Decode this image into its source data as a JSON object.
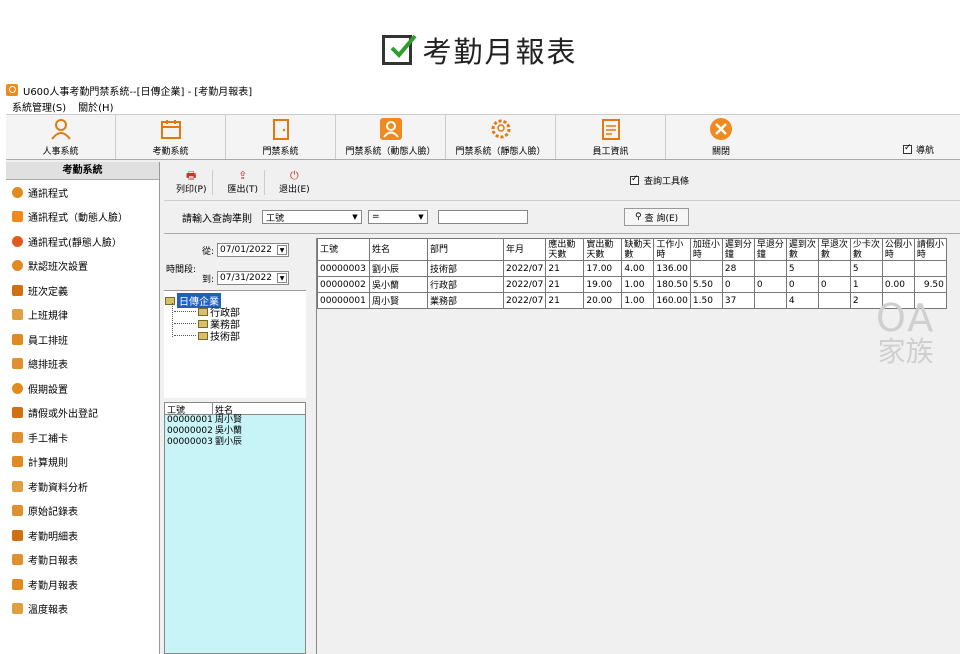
{
  "banner": {
    "title": "考勤月報表"
  },
  "app": {
    "window_title": "U600人事考勤門禁系統--[日傳企業] - [考勤月報表]",
    "menu": [
      "系統管理(S)",
      "關於(H)"
    ]
  },
  "toolbar": {
    "buttons": [
      {
        "label": "人事系統",
        "icon": "person-icon"
      },
      {
        "label": "考勤系統",
        "icon": "calendar-icon"
      },
      {
        "label": "門禁系統",
        "icon": "door-icon"
      },
      {
        "label": "門禁系統（動態人臉）",
        "icon": "face-icon"
      },
      {
        "label": "門禁系統（靜態人臉）",
        "icon": "gear-face-icon"
      },
      {
        "label": "員工資訊",
        "icon": "document-icon"
      },
      {
        "label": "關閉",
        "icon": "close-icon"
      }
    ],
    "nav_label": "導航"
  },
  "sidebar": {
    "header": "考勤系統",
    "items": [
      "通訊程式",
      "通訊程式（動態人臉）",
      "通訊程式(靜態人臉）",
      "默認班次設置",
      "班次定義",
      "上班規律",
      "員工排班",
      "總排班表",
      "假期設置",
      "請假或外出登記",
      "手工補卡",
      "計算規則",
      "考勤資料分析",
      "原始記錄表",
      "考勤明細表",
      "考勤日報表",
      "考勤月報表",
      "溫度報表"
    ]
  },
  "actions": {
    "print": "列印(P)",
    "export": "匯出(T)",
    "exit": "退出(E)",
    "query_toolbar": "查詢工具條"
  },
  "query": {
    "label": "請輸入查詢準則",
    "field": "工號",
    "operator": "=",
    "value": "",
    "button": "查 詢(E)"
  },
  "filter": {
    "period_label": "時間段:",
    "from_label": "從:",
    "to_label": "到:",
    "from_date": "07/01/2022",
    "to_date": "07/31/2022"
  },
  "tree": {
    "root": "日傳企業",
    "children": [
      "行政部",
      "業務部",
      "技術部"
    ]
  },
  "employees": {
    "headers": [
      "工號",
      "姓名"
    ],
    "rows": [
      [
        "00000001",
        "周小賢"
      ],
      [
        "00000002",
        "吳小蘭"
      ],
      [
        "00000003",
        "劉小辰"
      ]
    ]
  },
  "report": {
    "headers": [
      "工號",
      "姓名",
      "部門",
      "年月",
      "應出勤天數",
      "實出勤天數",
      "缺勤天數",
      "工作小時",
      "加班小時",
      "遲到分鐘",
      "早退分鐘",
      "遲到次數",
      "早退次數",
      "少卡次數",
      "公假小時",
      "請假小時"
    ],
    "rows": [
      [
        "00000003",
        "劉小辰",
        "技術部",
        "2022/07",
        "21",
        "17.00",
        "4.00",
        "136.00",
        "",
        "28",
        "",
        "5",
        "",
        "5",
        "",
        ""
      ],
      [
        "00000002",
        "吳小蘭",
        "行政部",
        "2022/07",
        "21",
        "19.00",
        "1.00",
        "180.50",
        "5.50",
        "0",
        "0",
        "0",
        "0",
        "1",
        "0.00",
        "9.50"
      ],
      [
        "00000001",
        "周小賢",
        "業務部",
        "2022/07",
        "21",
        "20.00",
        "1.00",
        "160.00",
        "1.50",
        "37",
        "",
        "4",
        "",
        "2",
        "",
        ""
      ]
    ]
  },
  "watermark": {
    "line1": "OA",
    "line2": "家族"
  },
  "colors": {
    "accent": "#f08a1c",
    "employee_list_bg": "#c8f4f8",
    "tree_selection": "#1f5fbf"
  }
}
